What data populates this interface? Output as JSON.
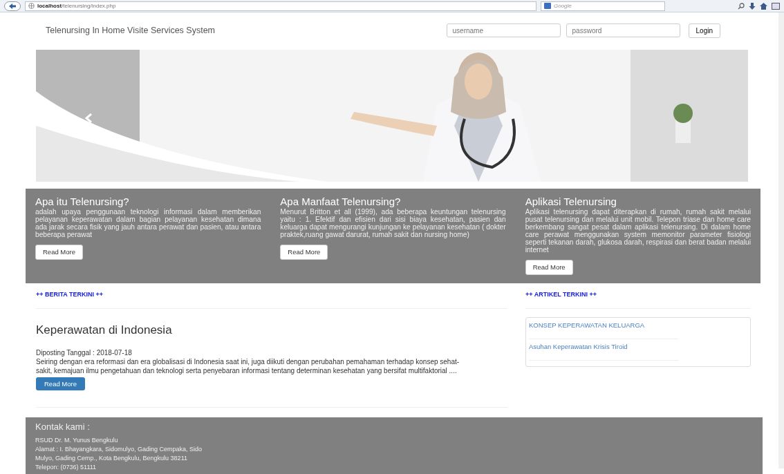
{
  "browser": {
    "url_host": "localhost",
    "url_path": "/telenursing/index.php",
    "search_placeholder": "Google"
  },
  "navbar": {
    "brand": "Telenursing In Home Visite Services System",
    "username_placeholder": "username",
    "password_placeholder": "password",
    "login": "Login"
  },
  "features": [
    {
      "title": "Apa itu Telenursing?",
      "body": "adalah upaya penggunaan teknologi informasi dalam memberikan pelayanan keperawatan dalam bagian pelayanan kesehatan dimana ada jarak secara fisik yang jauh antara perawat dan pasien, atau antara beberapa perawat",
      "button": "Read More"
    },
    {
      "title": "Apa Manfaat Telenursing?",
      "body": "Menurut Britton et all (1999), ada beberapa keuntungan telenursing yaitu : 1. Efektif dan efisien dari sisi biaya kesehatan, pasien dan keluarga dapat mengurangi kunjungan ke pelayanan kesehatan ( dokter praktek,ruang gawat darurat, rumah sakit dan nursing home)",
      "button": "Read More"
    },
    {
      "title": "Aplikasi Telenursing",
      "body": "Aplikasi telenursing dapat diterapkan di rumah, rumah sakit melalui pusat telenursing dan melalui unit mobil. Telepon triase dan home care berkembang sangat pesat dalam aplikasi telenursing. Di dalam home care perawat menggunakan system memonitor parameter fisiologi seperti tekanan darah, glukosa darah, respirasi dan berat badan melalui internet",
      "button": "Read More"
    }
  ],
  "news": {
    "heading": "++ BERITA TERKINI ++",
    "title": "Keperawatan di Indonesia",
    "date": "Diposting Tanggal : 2018-07-18",
    "body": "Seiring dengan era reformasi dan era globalisasi di Indonesia saat ini, juga diikuti dengan perubahan pemahaman terhadap konsep sehat-sakit, kemajuan ilmu pengetahuan dan teknologi serta penyebaran informasi tentang determinan kesehatan yang bersifat multifaktorial ....",
    "button": "Read More"
  },
  "articles": {
    "heading": "++ ARTIKEL TERKINI ++",
    "items": [
      "KONSEP KEPERAWATAN KELUARGA",
      "Asuhan Keperawatan Krisis Tiroid"
    ]
  },
  "footer": {
    "title": "Kontak kami :",
    "lines": [
      "RSUD Dr. M. Yunus Bengkulu",
      "Alamat : I. Bhayangkara, Sidomulyo, Gading Cempaka, Sido",
      "Mulyo, Gading Cemp., Kota Bengkulu, Bengkulu 38211",
      "Telepon: (0736) 51111"
    ]
  }
}
